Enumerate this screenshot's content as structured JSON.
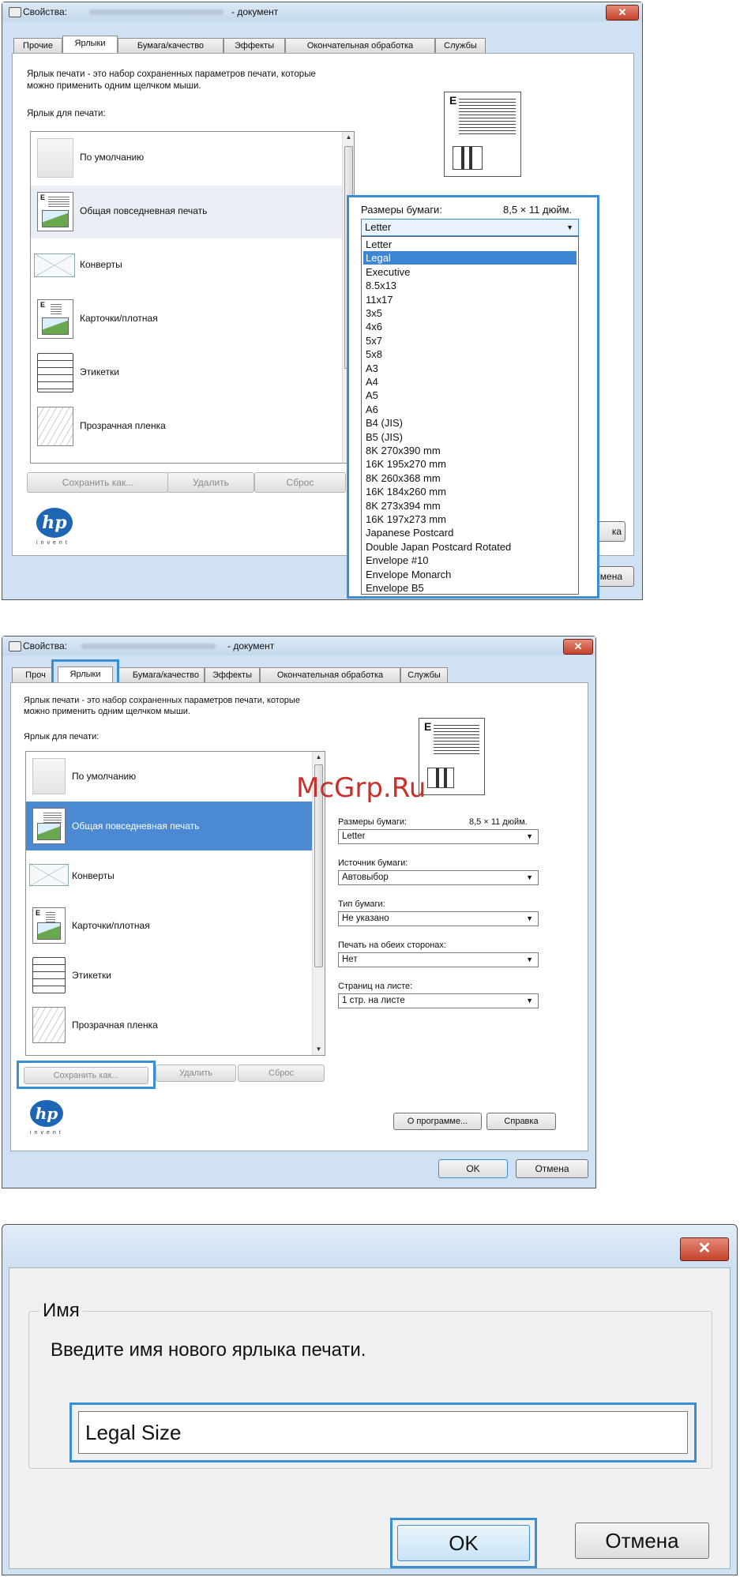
{
  "watermark": "McGrp.Ru",
  "win1": {
    "title_prefix": "Свойства:",
    "title_suffix": "- документ",
    "close_glyph": "✕",
    "tabs": [
      "Прочие",
      "Ярлыки",
      "Бумага/качество",
      "Эффекты",
      "Окончательная обработка",
      "Службы"
    ],
    "desc1": "Ярлык печати - это набор сохраненных параметров печати, которые",
    "desc2": "можно применить одним щелчком мыши.",
    "shortcut_label": "Ярлык для печати:",
    "items": [
      "По умолчанию",
      "Общая повседневная печать",
      "Конверты",
      "Карточки/плотная",
      "Этикетки",
      "Прозрачная пленка"
    ],
    "buttons": {
      "save_as": "Сохранить как...",
      "delete": "Удалить",
      "reset": "Сброс",
      "about_partial": "ка",
      "cancel_partial": "Отмена"
    },
    "paper_size_label": "Размеры бумаги:",
    "paper_size_value": "8,5 × 11 дюйм.",
    "paper_combo_value": "Letter",
    "dropdown_options": [
      "Letter",
      "Legal",
      "Executive",
      "8.5x13",
      "11x17",
      "3x5",
      "4x6",
      "5x7",
      "5x8",
      "A3",
      "A4",
      "A5",
      "A6",
      "B4 (JIS)",
      "B5 (JIS)",
      "8K 270x390 mm",
      "16K 195x270 mm",
      "8K 260x368 mm",
      "16K 184x260 mm",
      "8K 273x394 mm",
      "16K 197x273 mm",
      "Japanese Postcard",
      "Double Japan Postcard Rotated",
      "Envelope #10",
      "Envelope Monarch",
      "Envelope B5"
    ],
    "dropdown_selected": "Legal",
    "hp_logo": "hp",
    "hp_invent": "invent"
  },
  "win2": {
    "title_prefix": "Свойства:",
    "title_suffix": "- документ",
    "close_glyph": "✕",
    "tabs": [
      "Проч",
      "Ярлыки",
      "Бумага/качество",
      "Эффекты",
      "Окончательная обработка",
      "Службы"
    ],
    "desc1": "Ярлык печати - это набор сохраненных параметров печати, которые",
    "desc2": "можно применить одним щелчком мыши.",
    "shortcut_label": "Ярлык для печати:",
    "items": [
      "По умолчанию",
      "Общая повседневная печать",
      "Конверты",
      "Карточки/плотная",
      "Этикетки",
      "Прозрачная пленка"
    ],
    "fields": [
      {
        "label": "Размеры бумаги:",
        "value": "Letter",
        "extra": "8,5 × 11 дюйм."
      },
      {
        "label": "Источник бумаги:",
        "value": "Автовыбор"
      },
      {
        "label": "Тип бумаги:",
        "value": "Не указано"
      },
      {
        "label": "Печать на обеих сторонах:",
        "value": "Нет"
      },
      {
        "label": "Страниц на листе:",
        "value": "1 стр. на листе"
      }
    ],
    "buttons": {
      "save_as": "Сохранить как...",
      "delete": "Удалить",
      "reset": "Сброс",
      "about": "О программе...",
      "help": "Справка",
      "ok": "OK",
      "cancel": "Отмена"
    },
    "hp_logo": "hp",
    "hp_invent": "invent"
  },
  "dlg3": {
    "close_glyph": "✕",
    "group_label": "Имя",
    "prompt": "Введите имя нового ярлыка печати.",
    "input_value": "Legal Size",
    "ok": "OK",
    "cancel": "Отмена"
  }
}
